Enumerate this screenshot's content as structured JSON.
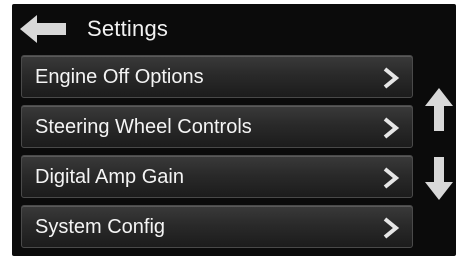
{
  "header": {
    "title": "Settings",
    "back_icon": "left-arrow-icon"
  },
  "menu": {
    "items": [
      {
        "label": "Engine Off Options",
        "icon": "chevron-right-icon"
      },
      {
        "label": "Steering Wheel Controls",
        "icon": "chevron-right-icon"
      },
      {
        "label": "Digital Amp Gain",
        "icon": "chevron-right-icon"
      },
      {
        "label": "System Config",
        "icon": "chevron-right-icon"
      }
    ]
  },
  "scroll": {
    "up_icon": "arrow-up-icon",
    "down_icon": "arrow-down-icon"
  },
  "colors": {
    "background": "#0b0b0b",
    "button_top": "#3a3a3a",
    "button_bottom": "#1c1c1c",
    "text": "#f4f4f4",
    "icon": "#d8d8d8"
  }
}
